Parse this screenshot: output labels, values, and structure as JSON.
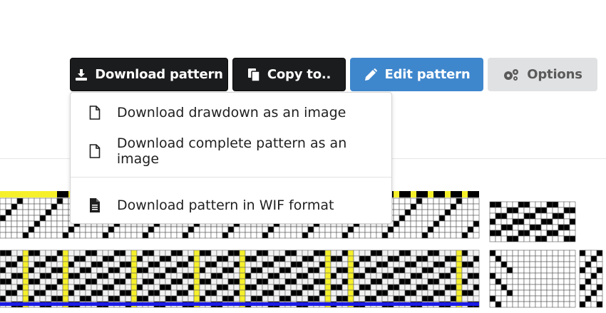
{
  "toolbar": {
    "download_label": "Download pattern",
    "copy_label": "Copy to..",
    "edit_label": "Edit pattern",
    "options_label": "Options"
  },
  "download_menu": {
    "items": [
      {
        "label": "Download drawdown as an image",
        "icon": "file-outline-icon"
      },
      {
        "label": "Download complete pattern as an image",
        "icon": "file-outline-icon"
      },
      {
        "label": "Download pattern in WIF format",
        "icon": "file-text-icon"
      }
    ]
  },
  "colors": {
    "dark_button": "#1b1c1d",
    "primary_button": "#3f87cd",
    "secondary_button": "#e0e1e2",
    "thread_yellow": "#f5f02a",
    "thread_blue": "#1a1ae6",
    "thread_black": "#000000"
  }
}
